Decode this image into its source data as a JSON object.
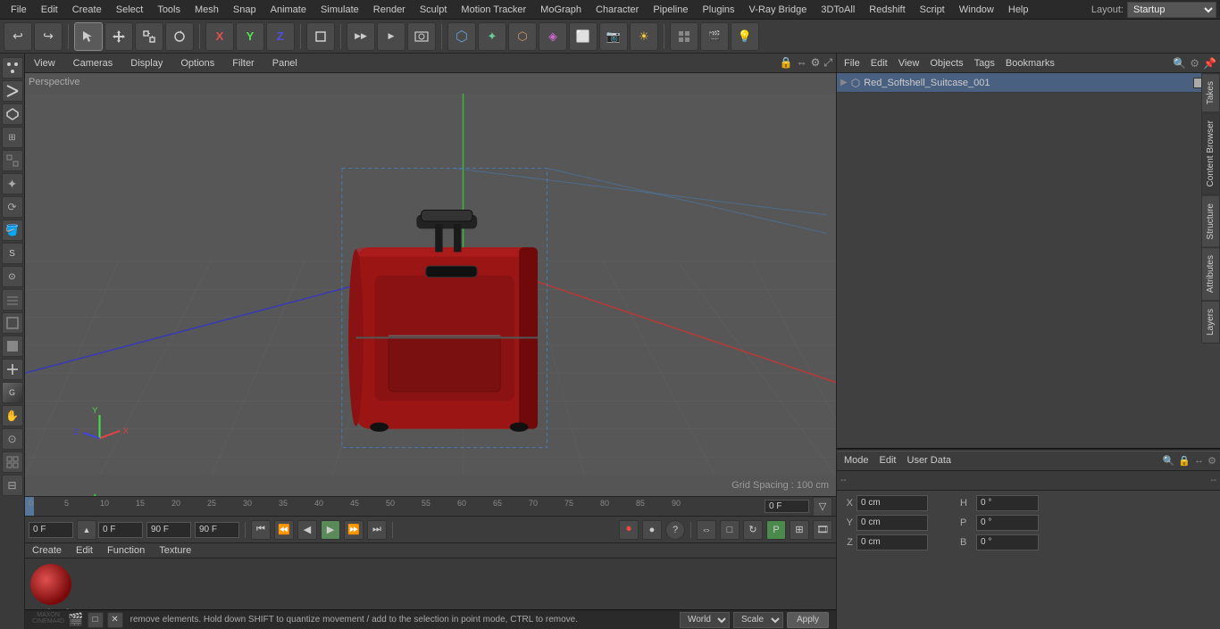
{
  "menubar": {
    "items": [
      "File",
      "Edit",
      "Create",
      "Select",
      "Tools",
      "Mesh",
      "Snap",
      "Animate",
      "Simulate",
      "Render",
      "Sculpt",
      "Motion Tracker",
      "MoGraph",
      "Character",
      "Pipeline",
      "Plugins",
      "V-Ray Bridge",
      "3DToAll",
      "Redshift",
      "Script",
      "Window",
      "Help"
    ],
    "layout_label": "Layout:",
    "layout_value": "Startup"
  },
  "viewport": {
    "view_menus": [
      "View",
      "Cameras",
      "Display",
      "Options",
      "Filter",
      "Panel"
    ],
    "mode_label": "Perspective",
    "grid_spacing": "Grid Spacing : 100 cm"
  },
  "object_manager": {
    "menus": [
      "File",
      "Edit",
      "View",
      "Objects",
      "Tags",
      "Bookmarks"
    ],
    "object_name": "Red_Softshell_Suitcase_001"
  },
  "attributes": {
    "menus": [
      "Mode",
      "Edit",
      "User Data"
    ],
    "coords": {
      "x_pos": "0 cm",
      "y_pos": "0 cm",
      "z_pos": "0 cm",
      "h_rot": "0 °",
      "p_rot": "0 °",
      "b_rot": "0 °"
    }
  },
  "timeline": {
    "current_frame": "0 F",
    "start_frame": "0 F",
    "end_frame": "90 F",
    "preview_end": "90 F",
    "frame_indicator": "0 F",
    "ticks": [
      "0",
      "5",
      "10",
      "15",
      "20",
      "25",
      "30",
      "35",
      "40",
      "45",
      "50",
      "55",
      "60",
      "65",
      "70",
      "75",
      "80",
      "85",
      "90"
    ]
  },
  "playback": {
    "current_time": "0 F",
    "start_time": "0 F",
    "end_time": "90 F",
    "preview_end": "90 F"
  },
  "material": {
    "name": "Red_Sof",
    "menus": [
      "Create",
      "Edit",
      "Function",
      "Texture"
    ]
  },
  "status_bar": {
    "text": "remove elements. Hold down SHIFT to quantize movement / add to the selection in point mode, CTRL to remove.",
    "world_label": "World",
    "scale_label": "Scale",
    "apply_label": "Apply"
  },
  "right_tabs": [
    "Takes",
    "Content Browser",
    "Structure",
    "Attributes",
    "Layers"
  ],
  "toolbar": {
    "undo_icon": "↩",
    "redo_icon": "↪"
  }
}
